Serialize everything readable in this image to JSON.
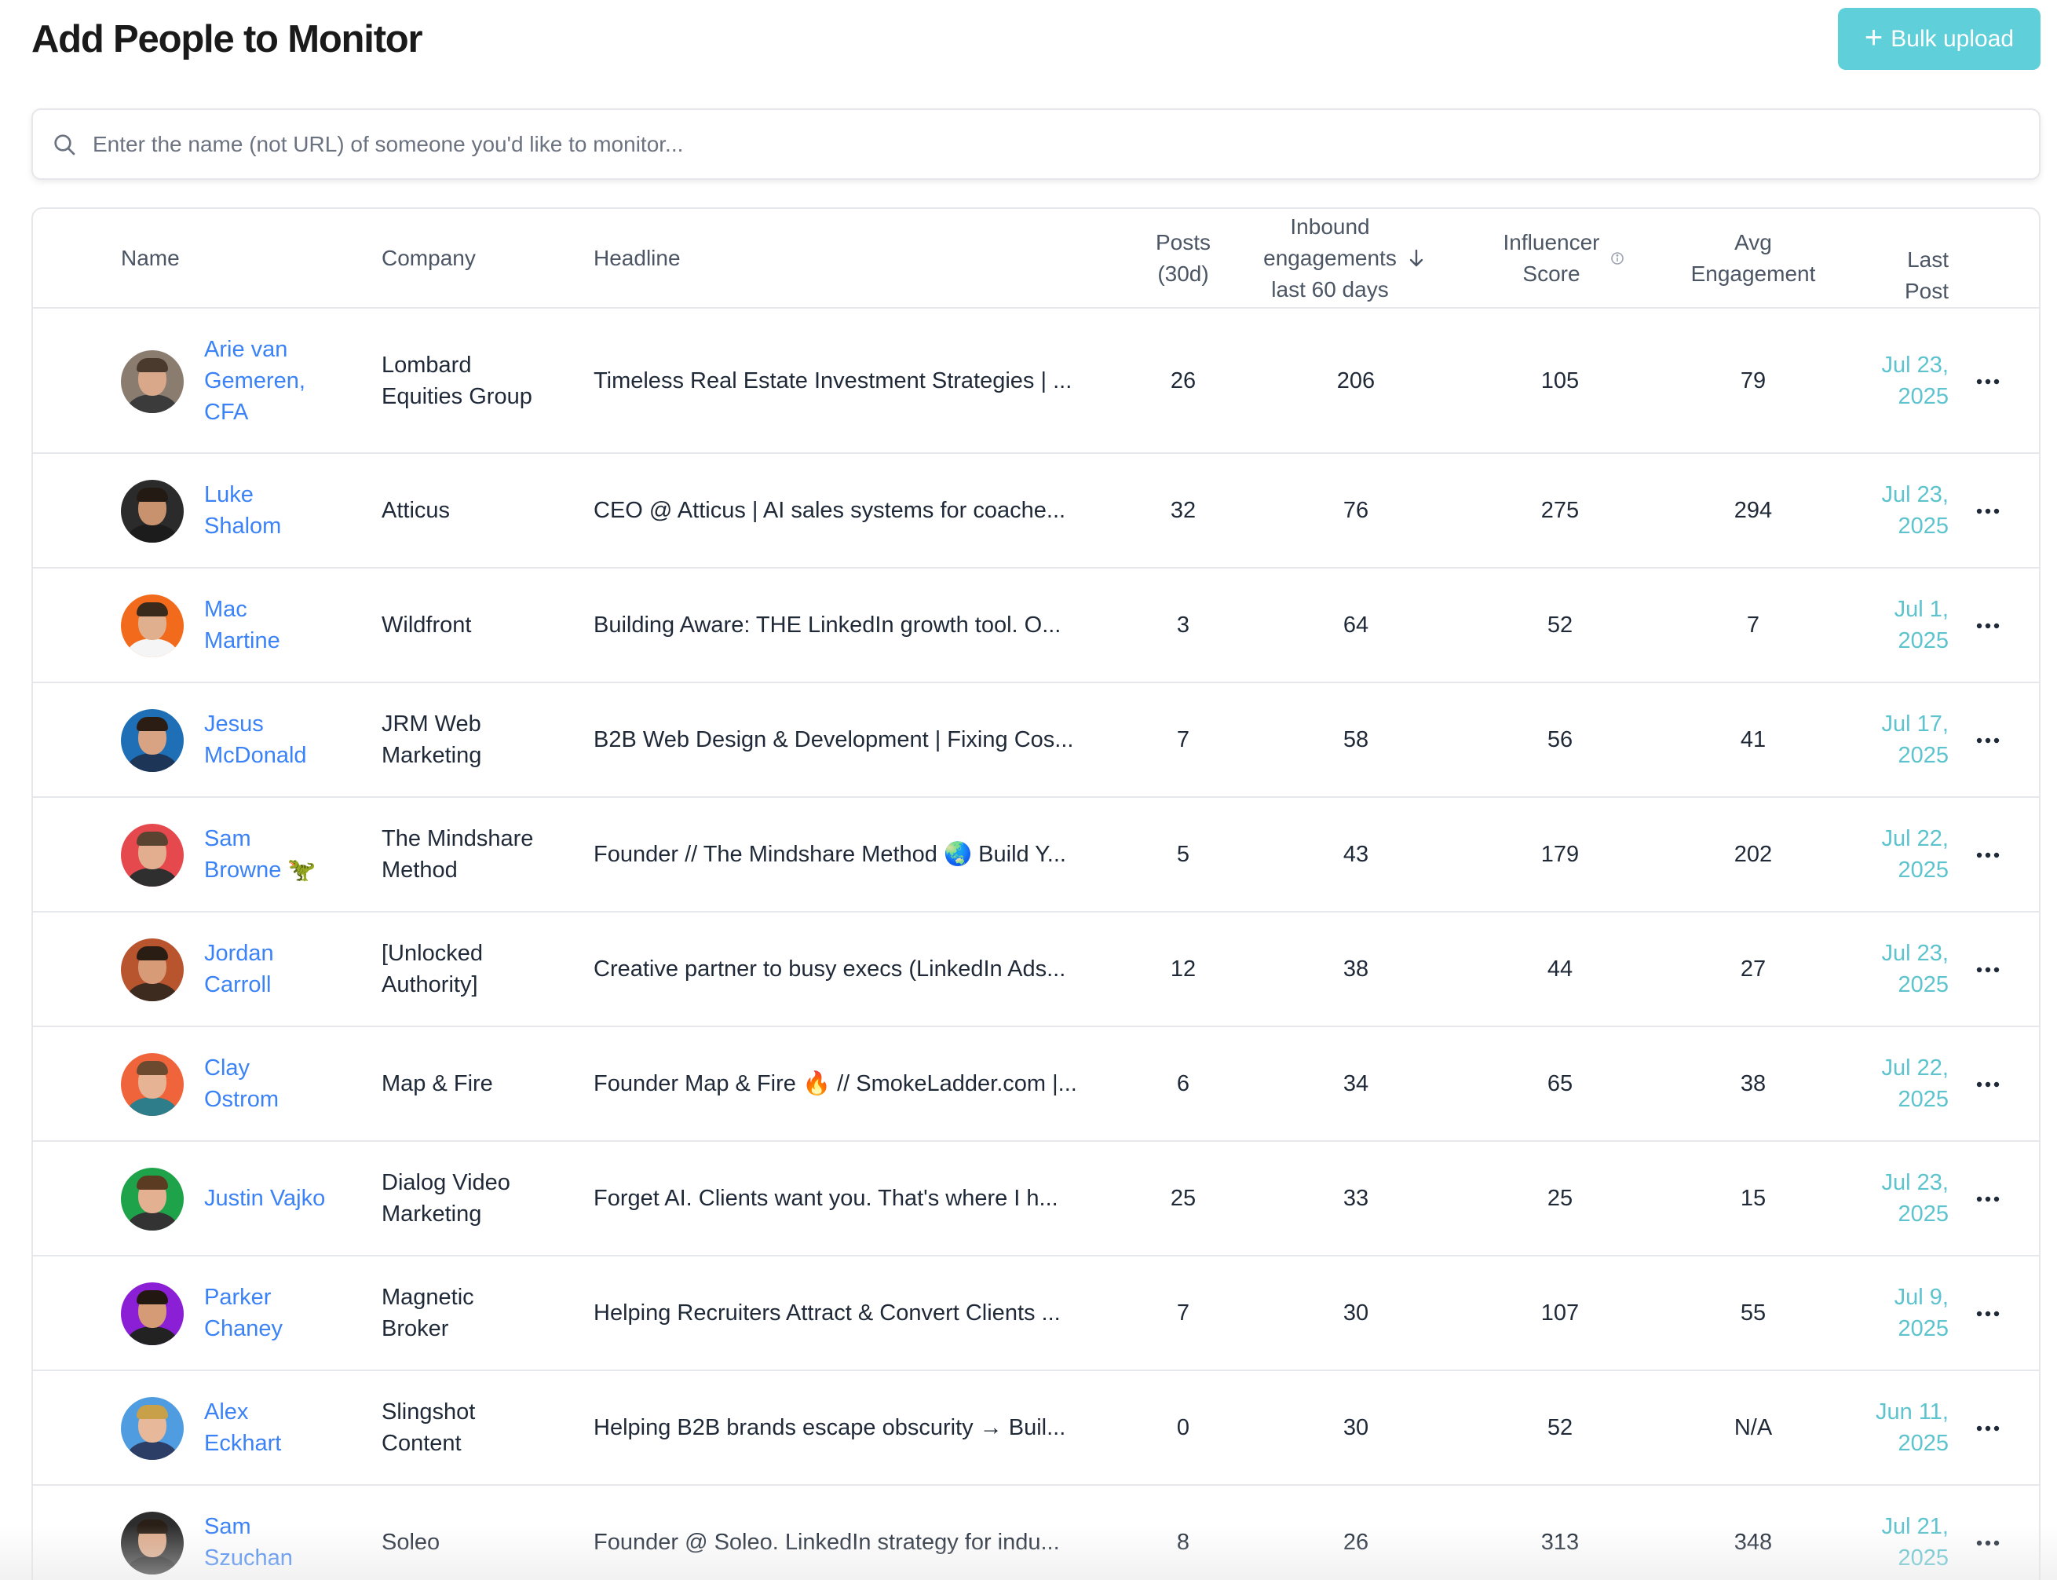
{
  "header": {
    "title": "Add People to Monitor",
    "bulk_upload_label": "Bulk upload"
  },
  "search": {
    "placeholder": "Enter the name (not URL) of someone you'd like to monitor..."
  },
  "table": {
    "columns": {
      "name": "Name",
      "company": "Company",
      "headline": "Headline",
      "posts_l1": "Posts",
      "posts_l2": "(30d)",
      "inbound_l1": "Inbound",
      "inbound_l2": "engagements",
      "inbound_l3": "last 60 days",
      "influencer_l1": "Influencer",
      "influencer_l2": "Score",
      "avg_l1": "Avg",
      "avg_l2": "Engagement",
      "last_l1": "Last",
      "last_l2": "Post"
    },
    "sort_icon": "arrow-down-icon",
    "info_icon": "info-circle-icon",
    "rows": [
      {
        "name": [
          "Arie van",
          "Gemeren,",
          "CFA"
        ],
        "company": [
          "Lombard",
          "Equities Group"
        ],
        "headline": "Timeless Real Estate Investment Strategies | ...",
        "posts": "26",
        "inbound": "206",
        "influencer": "105",
        "avg": "79",
        "date": [
          "Jul 23,",
          "2025"
        ],
        "avatar_bg": "#8a7d70",
        "skin": "#d9a88a",
        "shirt": "#3b3b3b",
        "hair": "#4a3a2e"
      },
      {
        "name": [
          "Luke",
          "Shalom"
        ],
        "company": [
          "Atticus"
        ],
        "headline": "CEO @ Atticus | AI sales systems for coache...",
        "posts": "32",
        "inbound": "76",
        "influencer": "275",
        "avg": "294",
        "date": [
          "Jul 23,",
          "2025"
        ],
        "avatar_bg": "#2b2b2b",
        "skin": "#c9926f",
        "shirt": "#1c1c1c",
        "hair": "#241a14"
      },
      {
        "name": [
          "Mac",
          "Martine"
        ],
        "company": [
          "Wildfront"
        ],
        "headline": "Building Aware: THE LinkedIn growth tool. O...",
        "posts": "3",
        "inbound": "64",
        "influencer": "52",
        "avg": "7",
        "date": [
          "Jul 1,",
          "2025"
        ],
        "avatar_bg": "#f26a1b",
        "skin": "#e0b08e",
        "shirt": "#f5f5f5",
        "hair": "#3a2a1c"
      },
      {
        "name": [
          "Jesus",
          "McDonald"
        ],
        "company": [
          "JRM Web",
          "Marketing"
        ],
        "headline": "B2B Web Design & Development | Fixing Cos...",
        "posts": "7",
        "inbound": "58",
        "influencer": "56",
        "avg": "41",
        "date": [
          "Jul 17,",
          "2025"
        ],
        "avatar_bg": "#1e6fb5",
        "skin": "#d8a383",
        "shirt": "#1d3557",
        "hair": "#2b1d14"
      },
      {
        "name": [
          "Sam",
          "Browne 🦖"
        ],
        "company": [
          "The Mindshare",
          "Method"
        ],
        "headline": "Founder // The Mindshare Method 🌏 Build Y...",
        "posts": "5",
        "inbound": "43",
        "influencer": "179",
        "avg": "202",
        "date": [
          "Jul 22,",
          "2025"
        ],
        "avatar_bg": "#e5484d",
        "skin": "#e2ae8f",
        "shirt": "#2f2f2f",
        "hair": "#5a4330"
      },
      {
        "name": [
          "Jordan",
          "Carroll"
        ],
        "company": [
          "[Unlocked",
          "Authority]"
        ],
        "headline": "Creative partner to busy execs (LinkedIn Ads...",
        "posts": "12",
        "inbound": "38",
        "influencer": "44",
        "avg": "27",
        "date": [
          "Jul 23,",
          "2025"
        ],
        "avatar_bg": "#b8542e",
        "skin": "#d89b78",
        "shirt": "#3d2b20",
        "hair": "#2a1d14"
      },
      {
        "name": [
          "Clay",
          "Ostrom"
        ],
        "company": [
          "Map & Fire"
        ],
        "headline": "Founder Map & Fire 🔥 // SmokeLadder.com |...",
        "posts": "6",
        "inbound": "34",
        "influencer": "65",
        "avg": "38",
        "date": [
          "Jul 22,",
          "2025"
        ],
        "avatar_bg": "#f0643c",
        "skin": "#e6b394",
        "shirt": "#2e7d8a",
        "hair": "#6b4a2f"
      },
      {
        "name": [
          "Justin Vajko"
        ],
        "company": [
          "Dialog Video",
          "Marketing"
        ],
        "headline": "Forget AI. Clients want you. That's where I h...",
        "posts": "25",
        "inbound": "33",
        "influencer": "25",
        "avg": "15",
        "date": [
          "Jul 23,",
          "2025"
        ],
        "avatar_bg": "#1fa34a",
        "skin": "#e3b092",
        "shirt": "#333333",
        "hair": "#5b3b22"
      },
      {
        "name": [
          "Parker",
          "Chaney"
        ],
        "company": [
          "Magnetic",
          "Broker"
        ],
        "headline": "Helping Recruiters Attract & Convert Clients ...",
        "posts": "7",
        "inbound": "30",
        "influencer": "107",
        "avg": "55",
        "date": [
          "Jul 9,",
          "2025"
        ],
        "avatar_bg": "#8b1fd6",
        "skin": "#d59a76",
        "shirt": "#222222",
        "hair": "#231811"
      },
      {
        "name": [
          "Alex",
          "Eckhart"
        ],
        "company": [
          "Slingshot",
          "Content"
        ],
        "headline": "Helping B2B brands escape obscurity → Buil...",
        "posts": "0",
        "inbound": "30",
        "influencer": "52",
        "avg": "N/A",
        "date": [
          "Jun 11,",
          "2025"
        ],
        "avatar_bg": "#4f9de0",
        "skin": "#e7b899",
        "shirt": "#2c3e66",
        "hair": "#c8a04a"
      },
      {
        "name": [
          "Sam",
          "Szuchan"
        ],
        "company": [
          "Soleo"
        ],
        "headline": "Founder @ Soleo. LinkedIn strategy for indu...",
        "posts": "8",
        "inbound": "26",
        "influencer": "313",
        "avg": "348",
        "date": [
          "Jul 21,",
          "2025"
        ],
        "avatar_bg": "#2d2d2d",
        "skin": "#dba888",
        "shirt": "#1a1a1a",
        "hair": "#2a1f17"
      }
    ]
  }
}
